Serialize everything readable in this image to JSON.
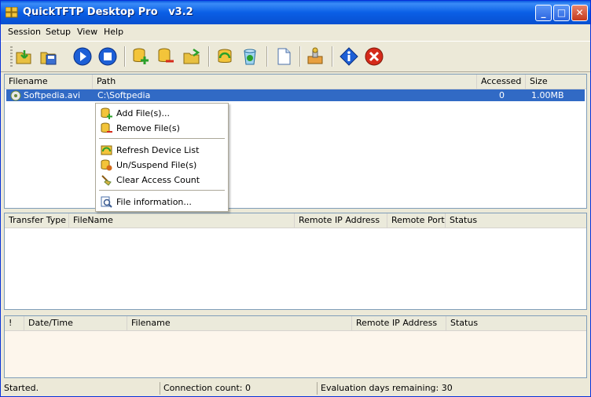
{
  "window": {
    "title": "QuickTFTP Desktop Pro   v3.2"
  },
  "title_buttons": {
    "minimize": "_",
    "maximize": "□",
    "close": "✕"
  },
  "menu": [
    {
      "label": "Session"
    },
    {
      "label": "Setup"
    },
    {
      "label": "View"
    },
    {
      "label": "Help"
    }
  ],
  "toolbar": [
    "open-folder-icon",
    "save-icon",
    "start-server-icon",
    "stop-server-icon",
    "add-file-icon",
    "remove-file-icon",
    "open-file-icon",
    "refresh-device-icon",
    "recycle-icon",
    "new-document-icon",
    "settings-icon",
    "info-icon",
    "exit-icon"
  ],
  "files_table": {
    "columns": [
      "Filename",
      "Path",
      "Accessed",
      "Size"
    ],
    "rows": [
      {
        "filename": "Softpedia.avi",
        "path": "C:\\Softpedia",
        "accessed": "0",
        "size": "1.00MB"
      }
    ]
  },
  "context_menu": {
    "items": [
      {
        "label": "Add File(s)...",
        "icon": "add-file-icon"
      },
      {
        "label": "Remove File(s)",
        "icon": "remove-file-icon"
      },
      {
        "label": "Refresh Device List",
        "icon": "refresh-device-icon"
      },
      {
        "label": "Un/Suspend File(s)",
        "icon": "suspend-file-icon"
      },
      {
        "label": "Clear Access Count",
        "icon": "broom-icon"
      },
      {
        "label": "File information...",
        "icon": "file-info-icon"
      }
    ]
  },
  "transfers_table": {
    "columns": [
      "Transfer Type",
      "FileName",
      "Remote IP Address",
      "Remote Port",
      "Status"
    ]
  },
  "log_table": {
    "columns": [
      "!",
      "Date/Time",
      "Filename",
      "Remote IP Address",
      "Status"
    ]
  },
  "status_bar": {
    "status": "Started.",
    "connections": "Connection count: 0",
    "evaluation": "Evaluation days remaining: 30"
  },
  "colors": {
    "title_bar": "#0a5fe6",
    "selection": "#316ac5",
    "log_background": "#fdf6ec"
  }
}
